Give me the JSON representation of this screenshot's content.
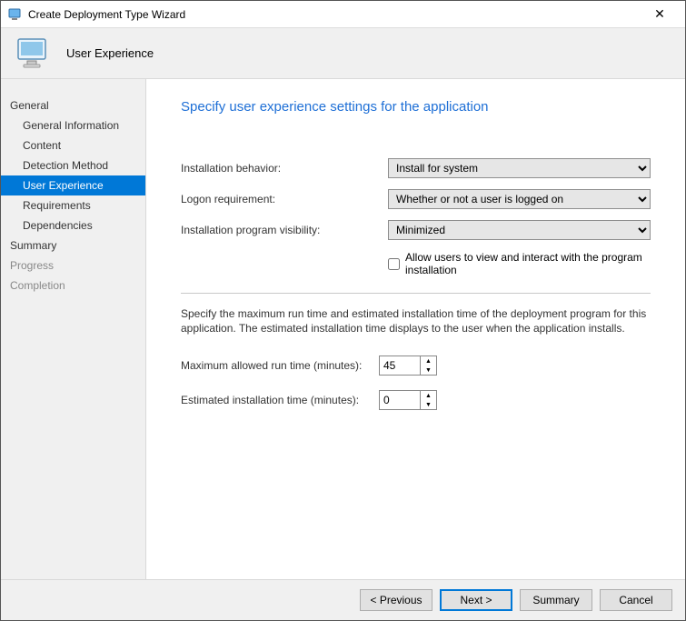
{
  "window": {
    "title": "Create Deployment Type Wizard"
  },
  "header": {
    "page": "User Experience"
  },
  "sidebar": {
    "groups": [
      {
        "label": "General"
      },
      {
        "label": "Summary"
      },
      {
        "label": "Progress"
      },
      {
        "label": "Completion"
      }
    ],
    "items": [
      {
        "label": "General Information"
      },
      {
        "label": "Content"
      },
      {
        "label": "Detection Method"
      },
      {
        "label": "User Experience"
      },
      {
        "label": "Requirements"
      },
      {
        "label": "Dependencies"
      }
    ]
  },
  "main": {
    "heading": "Specify user experience settings for the application",
    "labels": {
      "install_behavior": "Installation behavior:",
      "logon_req": "Logon requirement:",
      "visibility": "Installation program visibility:",
      "allow_interact": "Allow users to view and interact with the program installation",
      "desc": "Specify the maximum run time and estimated installation time of the deployment program for this application. The estimated installation time displays to the user when the application installs.",
      "max_run": "Maximum allowed run time (minutes):",
      "est_time": "Estimated installation time (minutes):"
    },
    "values": {
      "install_behavior": "Install for system",
      "logon_req": "Whether or not a user is logged on",
      "visibility": "Minimized",
      "allow_interact": false,
      "max_run": "45",
      "est_time": "0"
    }
  },
  "footer": {
    "previous": "< Previous",
    "next": "Next >",
    "summary": "Summary",
    "cancel": "Cancel"
  }
}
